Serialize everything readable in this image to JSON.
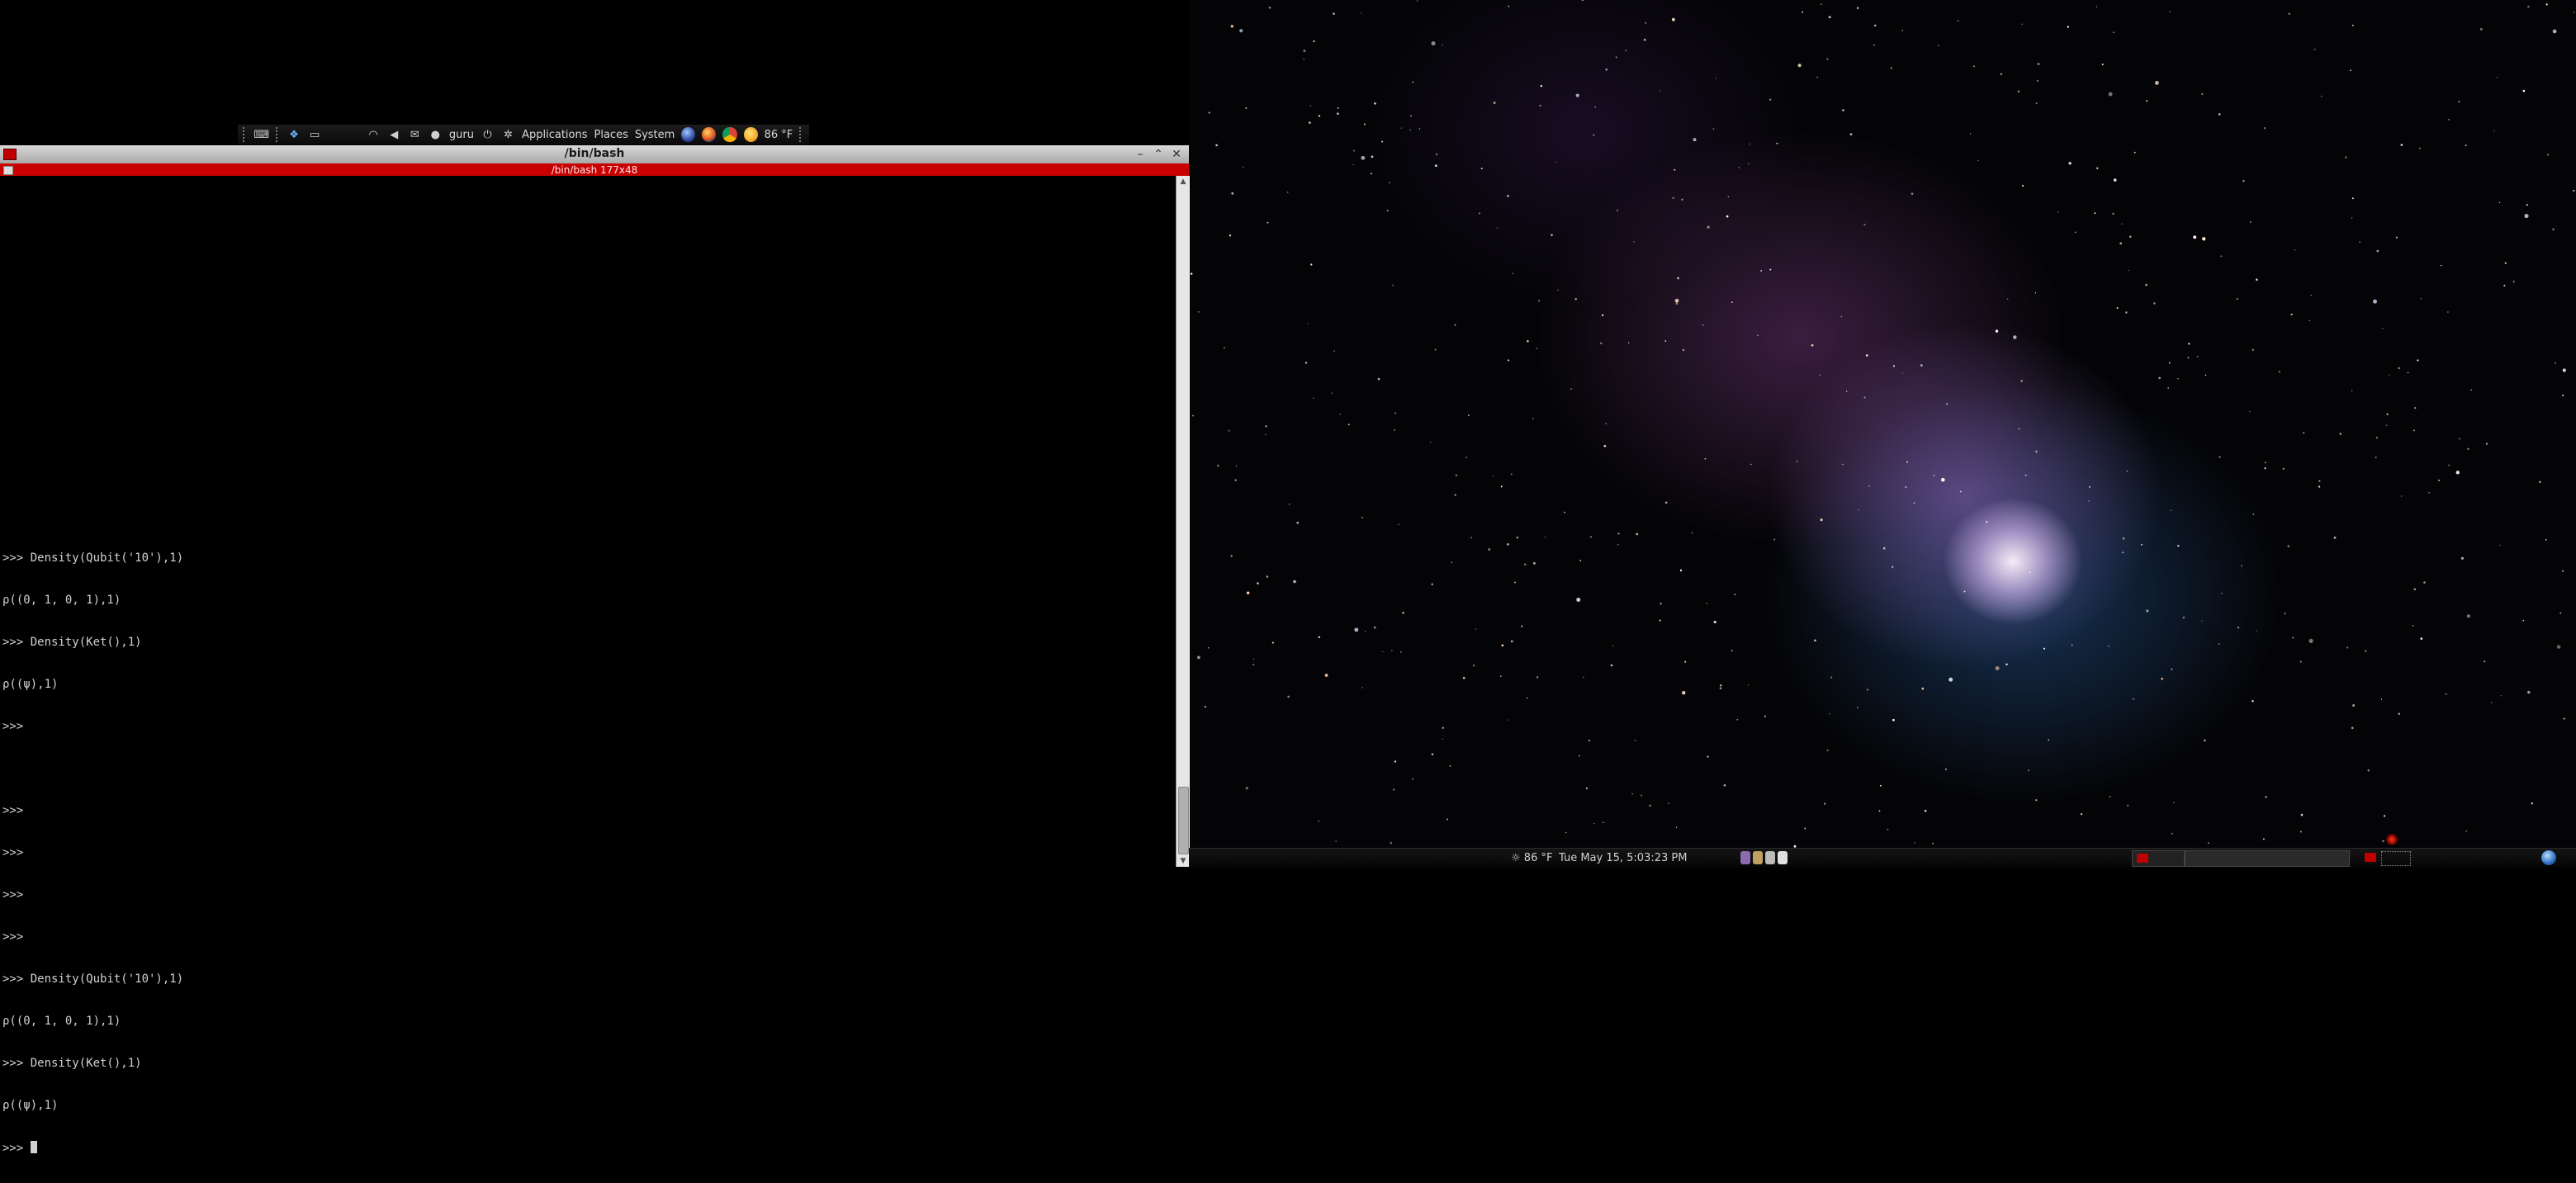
{
  "top_panel": {
    "user": "guru",
    "menus": [
      "Applications",
      "Places",
      "System"
    ],
    "weather": "86 °F",
    "icons": [
      "grip-icon",
      "keyboard-icon",
      "dropbox-icon",
      "display-icon",
      "wifi-icon",
      "volume-icon",
      "mail-icon",
      "chat-icon",
      "power-icon",
      "ubuntu-logo-icon",
      "globe-icon",
      "firefox-icon",
      "chrome-icon",
      "weather-icon"
    ]
  },
  "terminal": {
    "window_title": "/bin/bash",
    "tab_title": "/bin/bash 177x48",
    "lines": [
      ">>> Density(Qubit('10'),1)",
      "ρ((0, 1, 0, 1),1)",
      ">>> Density(Ket(),1)",
      "ρ((ψ),1)",
      ">>>",
      "",
      ">>>",
      ">>>",
      ">>>",
      ">>>",
      ">>> Density(Qubit('10'),1)",
      "ρ((0, 1, 0, 1),1)",
      ">>> Density(Ket(),1)",
      "ρ((ψ),1)",
      ">>>"
    ]
  },
  "bottom_panel": {
    "weather": "86 °F",
    "clock": "Tue May 15,  5:03:23 PM"
  },
  "colors": {
    "tab_bar": "#c80000",
    "terminal_bg": "#000000",
    "terminal_fg": "#d0d0d0"
  }
}
